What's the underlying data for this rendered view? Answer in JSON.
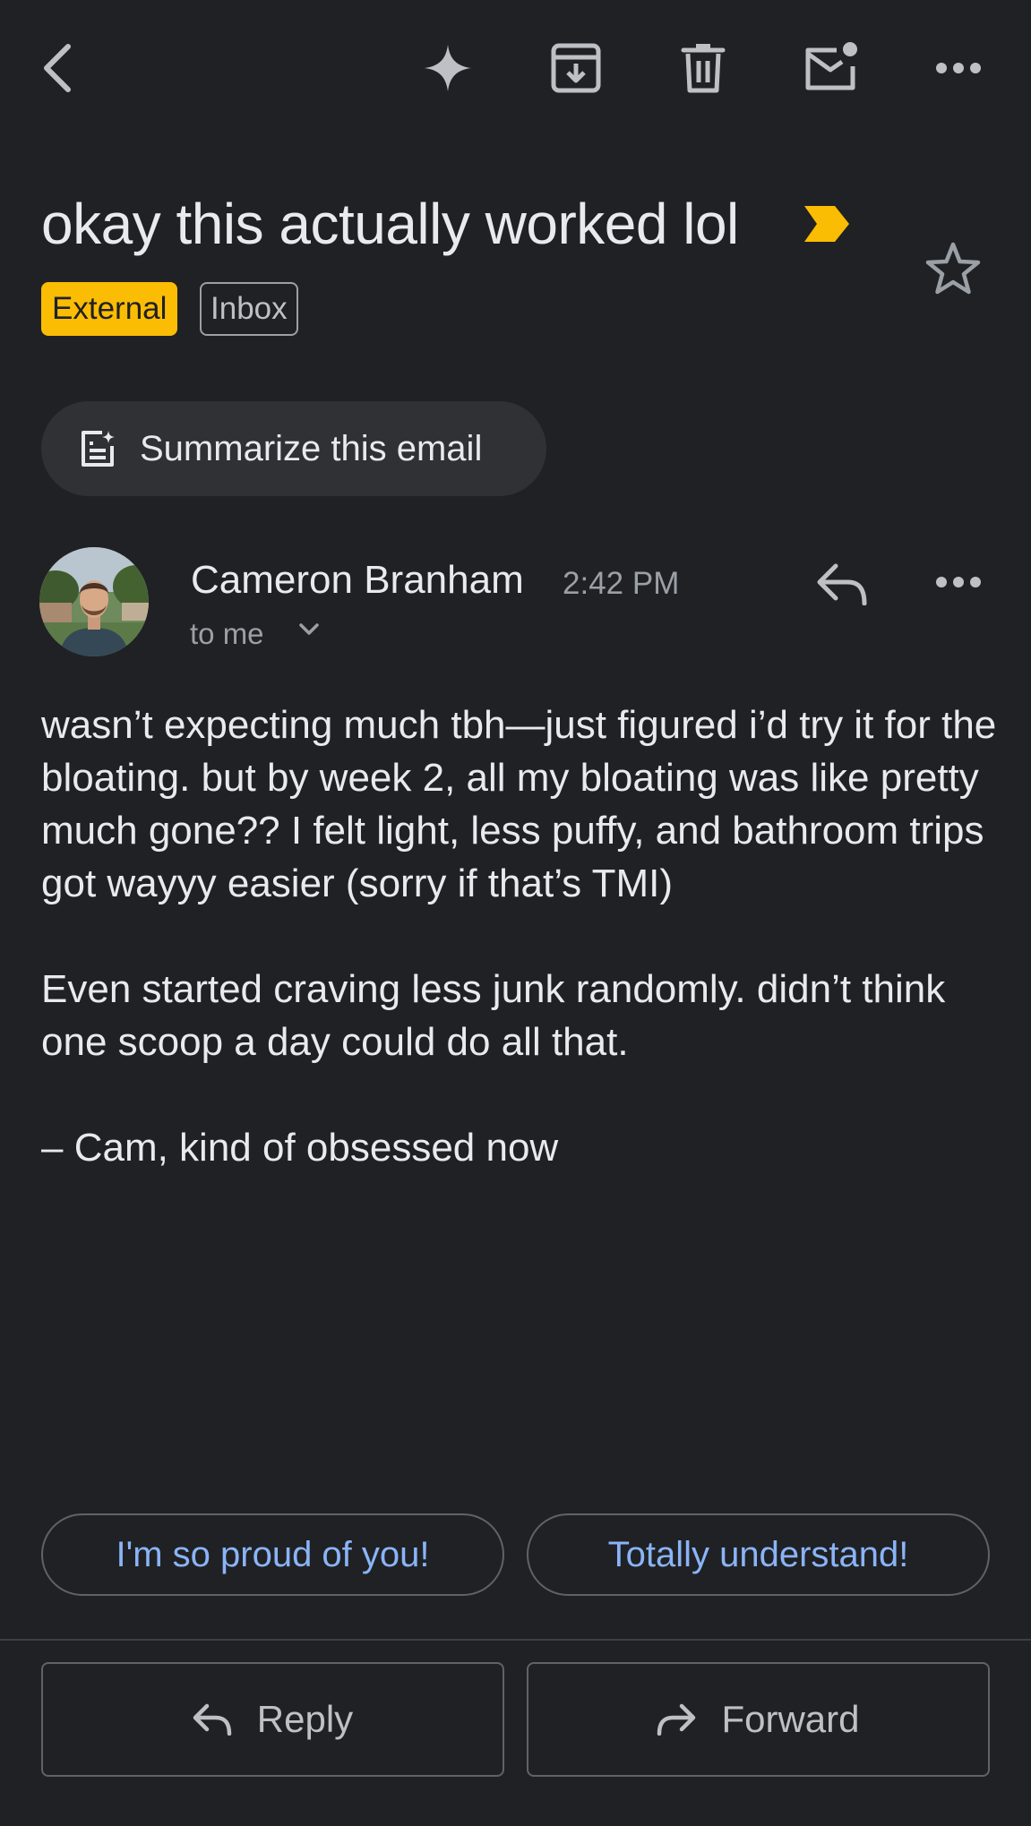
{
  "toolbar": {
    "icons": [
      "back-icon",
      "gemini-sparkle-icon",
      "archive-icon",
      "delete-icon",
      "mark-unread-icon",
      "more-icon"
    ]
  },
  "email": {
    "subject": "okay this actually worked lol",
    "labels": {
      "external": "External",
      "inbox": "Inbox"
    },
    "important_color": "#fbbc04"
  },
  "summarize": {
    "label": "Summarize this email"
  },
  "sender": {
    "name": "Cameron Branham",
    "time": "2:42 PM",
    "recipient": "to me"
  },
  "body": {
    "paragraphs": [
      "wasn’t expecting much tbh—just figured i’d try it for the bloating. but by week 2, all my bloating was like pretty much gone?? I felt light, less puffy, and bathroom trips got wayyy easier (sorry if that’s TMI)",
      "Even started craving less junk randomly. didn’t think one scoop a day could do all that.",
      "– Cam, kind of obsessed now"
    ]
  },
  "smart_replies": [
    "I'm so proud of you!",
    "Totally understand!"
  ],
  "actions": {
    "reply": "Reply",
    "forward": "Forward"
  },
  "colors": {
    "background": "#202124",
    "accent_link": "#8ab4f8",
    "external_label": "#fbbc04"
  }
}
